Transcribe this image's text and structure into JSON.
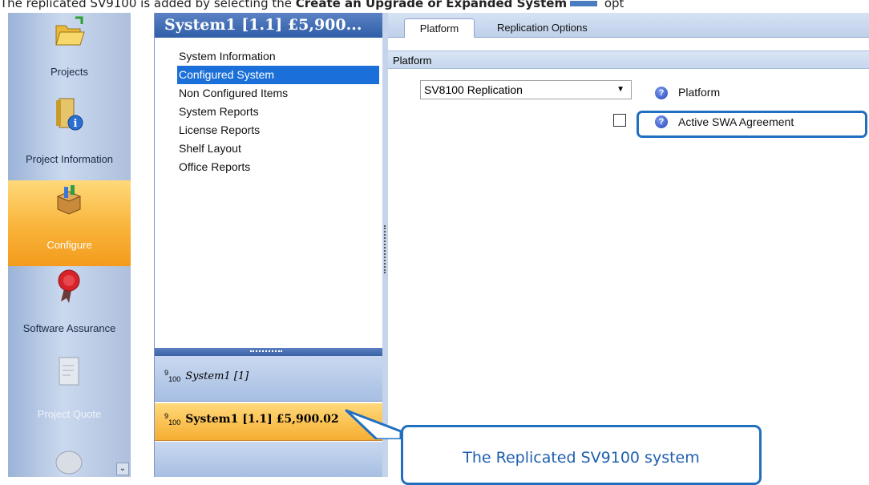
{
  "caption": {
    "prefix": "The replicated SV9100 is added by selecting the ",
    "bold": "Create an Upgrade or Expanded System",
    "suffix": " opt"
  },
  "nav": {
    "items": [
      {
        "label": "Projects",
        "icon": "open-folder-icon"
      },
      {
        "label": "Project Information",
        "icon": "info-binder-icon"
      },
      {
        "label": "Configure",
        "icon": "configure-box-icon"
      },
      {
        "label": "Software Assurance",
        "icon": "ribbon-seal-icon"
      },
      {
        "label": "Project Quote",
        "icon": "quote-document-icon"
      }
    ],
    "scroll_glyph": "⌄"
  },
  "tree": {
    "header": "System1 [1.1]  £5,900...",
    "items": [
      "System Information",
      "Configured System",
      "Non Configured Items",
      "System Reports",
      "License Reports",
      "Shelf Layout",
      "Office Reports"
    ],
    "selected_index": 1
  },
  "systems": [
    {
      "icon_sup": "9",
      "icon_sub": "100",
      "label": "System1 [1]"
    },
    {
      "icon_sup": "9",
      "icon_sub": "100",
      "label": "System1 [1.1]  £5,900.02"
    }
  ],
  "tabs": [
    "Platform",
    "Replication Options"
  ],
  "section_title": "Platform",
  "platform_select": {
    "value": "SV8100 Replication",
    "caret": "▼"
  },
  "help_glyph": "?",
  "fields": {
    "platform_label": "Platform",
    "swa_label": "Active SWA Agreement",
    "swa_checked": false
  },
  "callout": {
    "text": "The Replicated SV9100 system"
  },
  "colors": {
    "accent": "#2170c0",
    "active_orange": "#f6ae33",
    "selection_blue": "#1a6fd8"
  }
}
